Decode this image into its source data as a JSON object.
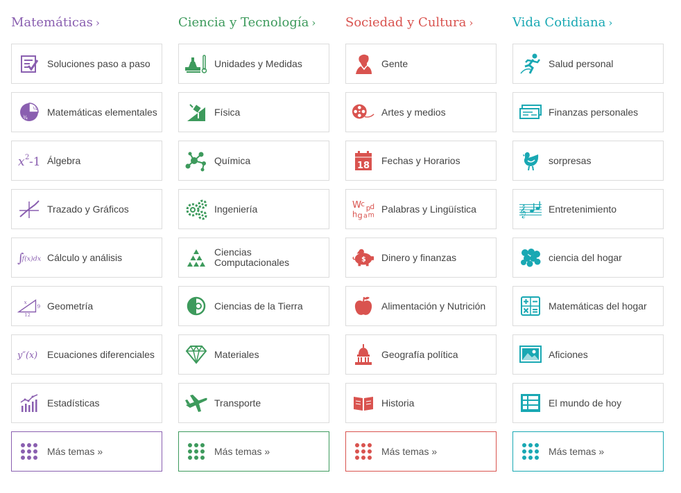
{
  "columns": [
    {
      "id": "math",
      "title": "Matemáticas",
      "chevron": "›",
      "color": "#8a5fb0",
      "items": [
        {
          "label": "Soluciones paso a paso",
          "icon": "checklist-icon"
        },
        {
          "label": "Matemáticas elementales",
          "icon": "fraction-pie-icon"
        },
        {
          "label": "Álgebra",
          "icon": "x-squared-minus-one-icon"
        },
        {
          "label": "Trazado y Gráficos",
          "icon": "graph-plot-icon"
        },
        {
          "label": "Cálculo y análisis",
          "icon": "integral-icon"
        },
        {
          "label": "Geometría",
          "icon": "triangle-ruler-icon"
        },
        {
          "label": "Ecuaciones diferenciales",
          "icon": "y-double-prime-icon"
        },
        {
          "label": "Estadísticas",
          "icon": "stats-chart-icon"
        }
      ],
      "more": "Más temas »"
    },
    {
      "id": "sci",
      "title": "Ciencia y Tecnología",
      "chevron": "›",
      "color": "#3d9a5c",
      "items": [
        {
          "label": "Unidades y Medidas",
          "icon": "scale-thermometer-icon"
        },
        {
          "label": "Física",
          "icon": "physics-ramp-icon"
        },
        {
          "label": "Química",
          "icon": "molecule-icon"
        },
        {
          "label": "Ingeniería",
          "icon": "gears-icon"
        },
        {
          "label": "Ciencias Computacionales",
          "icon": "triangle-dots-icon"
        },
        {
          "label": "Ciencias de la Tierra",
          "icon": "earth-icon"
        },
        {
          "label": "Materiales",
          "icon": "diamond-icon"
        },
        {
          "label": "Transporte",
          "icon": "airplane-icon"
        }
      ],
      "more": "Más temas »"
    },
    {
      "id": "soc",
      "title": "Sociedad y Cultura",
      "chevron": "›",
      "color": "#d9534f",
      "items": [
        {
          "label": "Gente",
          "icon": "portrait-icon"
        },
        {
          "label": "Artes y medios",
          "icon": "film-reel-icon"
        },
        {
          "label": "Fechas y Horarios",
          "icon": "calendar-icon"
        },
        {
          "label": "Palabras y Lingüística",
          "icon": "letters-icon"
        },
        {
          "label": "Dinero y finanzas",
          "icon": "piggy-bank-icon"
        },
        {
          "label": "Alimentación y Nutrición",
          "icon": "apple-icon"
        },
        {
          "label": "Geografía política",
          "icon": "capitol-icon"
        },
        {
          "label": "Historia",
          "icon": "open-book-icon"
        }
      ],
      "more": "Más temas »"
    },
    {
      "id": "life",
      "title": "Vida Cotidiana",
      "chevron": "›",
      "color": "#19a8b3",
      "items": [
        {
          "label": "Salud personal",
          "icon": "runner-icon"
        },
        {
          "label": "Finanzas personales",
          "icon": "check-stack-icon"
        },
        {
          "label": "sorpresas",
          "icon": "chicken-icon"
        },
        {
          "label": "Entretenimiento",
          "icon": "music-staff-icon"
        },
        {
          "label": "ciencia del hogar",
          "icon": "grapes-icon"
        },
        {
          "label": "Matemáticas del hogar",
          "icon": "calculator-icon"
        },
        {
          "label": "Aficiones",
          "icon": "picture-icon"
        },
        {
          "label": "El mundo de hoy",
          "icon": "stock-board-icon"
        }
      ],
      "more": "Más temas »"
    }
  ]
}
